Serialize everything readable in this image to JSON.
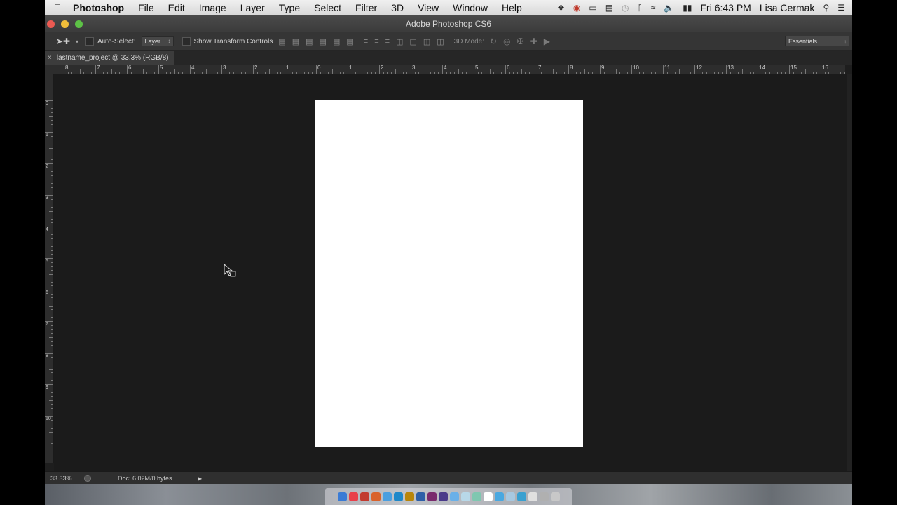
{
  "menubar": {
    "apple": "",
    "app_name": "Photoshop",
    "menus": [
      "File",
      "Edit",
      "Image",
      "Layer",
      "Type",
      "Select",
      "Filter",
      "3D",
      "View",
      "Window",
      "Help"
    ],
    "clock": "Fri 6:43 PM",
    "user": "Lisa Cermak"
  },
  "window": {
    "title": "Adobe Photoshop CS6"
  },
  "options": {
    "auto_select_label": "Auto-Select:",
    "auto_select_value": "Layer",
    "transform_label": "Show Transform Controls",
    "mode3d_label": "3D Mode:",
    "workspace": "Essentials"
  },
  "document": {
    "tab_title": "lastname_project @ 33.3% (RGB/8)",
    "close_glyph": "×"
  },
  "ruler": {
    "h_labels": [
      "8",
      "7",
      "6",
      "5",
      "4",
      "3",
      "2",
      "1",
      "0",
      "1",
      "2",
      "3",
      "4",
      "5",
      "6",
      "7",
      "8",
      "9",
      "10",
      "11",
      "12",
      "13",
      "14",
      "15",
      "16"
    ],
    "v_labels": [
      "0",
      "1",
      "2",
      "3",
      "4",
      "5",
      "6",
      "7",
      "8",
      "9",
      "10"
    ]
  },
  "status": {
    "zoom": "33.33%",
    "doc_info": "Doc: 6.02M/0 bytes",
    "arrow": "▶"
  },
  "dock": {
    "icon_colors": [
      "#3a7bd5",
      "#e8404a",
      "#c23b2f",
      "#d9622b",
      "#4a9fe0",
      "#1e88c9",
      "#b8860b",
      "#2d5fa8",
      "#7a2b6d",
      "#4a3a8a",
      "#6ab0e8",
      "#b8d8e8",
      "#7fc7b0",
      "#ffffff",
      "#4aa8e0",
      "#a8c8e0",
      "#3aa0d0",
      "#e0e0e0",
      "#b0b0b0",
      "#c8c8c8"
    ]
  }
}
